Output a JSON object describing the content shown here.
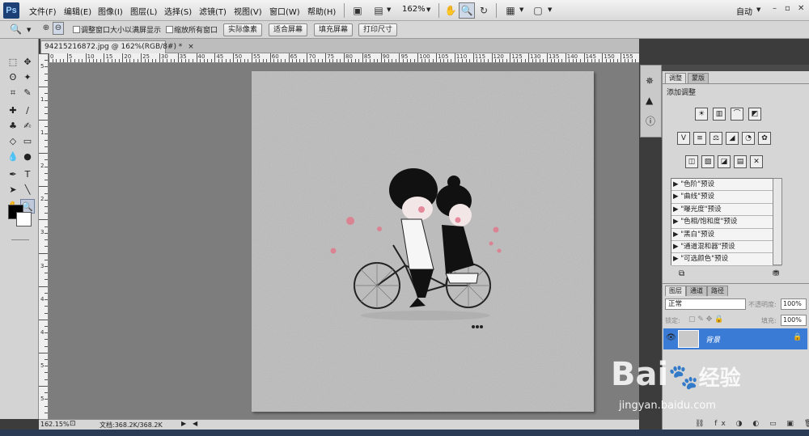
{
  "app": {
    "logo": "Ps"
  },
  "menu": {
    "items": [
      "文件(F)",
      "编辑(E)",
      "图像(I)",
      "图层(L)",
      "选择(S)",
      "滤镜(T)",
      "视图(V)",
      "窗口(W)",
      "帮助(H)"
    ],
    "zoom": "162%",
    "workspace": "自动"
  },
  "options": {
    "chk1": "调整窗口大小以满屏显示",
    "chk2": "缩放所有窗口",
    "btn_actual": "实际像素",
    "btn_fit": "适合屏幕",
    "btn_fill": "填充屏幕",
    "btn_print": "打印尺寸"
  },
  "doc": {
    "tab": "94215216872.jpg @ 162%(RGB/8#) *",
    "close": "×"
  },
  "rulers": {
    "h": [
      "0",
      "5",
      "10",
      "15",
      "20",
      "25",
      "30",
      "35",
      "40",
      "45",
      "50",
      "55",
      "60",
      "65",
      "70",
      "75",
      "80",
      "85",
      "90",
      "95",
      "100",
      "105",
      "110",
      "115",
      "120",
      "125",
      "130",
      "135",
      "140",
      "145",
      "150",
      "155"
    ],
    "v": [
      "5",
      "1",
      "1",
      "2",
      "2",
      "3",
      "3",
      "4",
      "4",
      "5",
      "5"
    ]
  },
  "status": {
    "zoom": "162.15%",
    "doc": "文档:368.2K/368.2K"
  },
  "adjust": {
    "tab_adjust": "调整",
    "tab_mask": "蒙版",
    "title": "添加调整",
    "presets": [
      "\"色阶\"预设",
      "\"曲线\"预设",
      "\"曝光度\"预设",
      "\"色相/饱和度\"预设",
      "\"黑白\"预设",
      "\"通道混和器\"预设",
      "\"可选颜色\"预设"
    ]
  },
  "layers": {
    "tabs": [
      "图层",
      "通道",
      "路径"
    ],
    "blend": "正常",
    "opacity_label": "不透明度:",
    "opacity": "100%",
    "lock_label": "锁定:",
    "fill_label": "填充:",
    "fill": "100%",
    "layer_name": "背景"
  },
  "watermark": {
    "brand": "Bai",
    "brand2": "经验",
    "url": "jingyan.baidu.com"
  }
}
